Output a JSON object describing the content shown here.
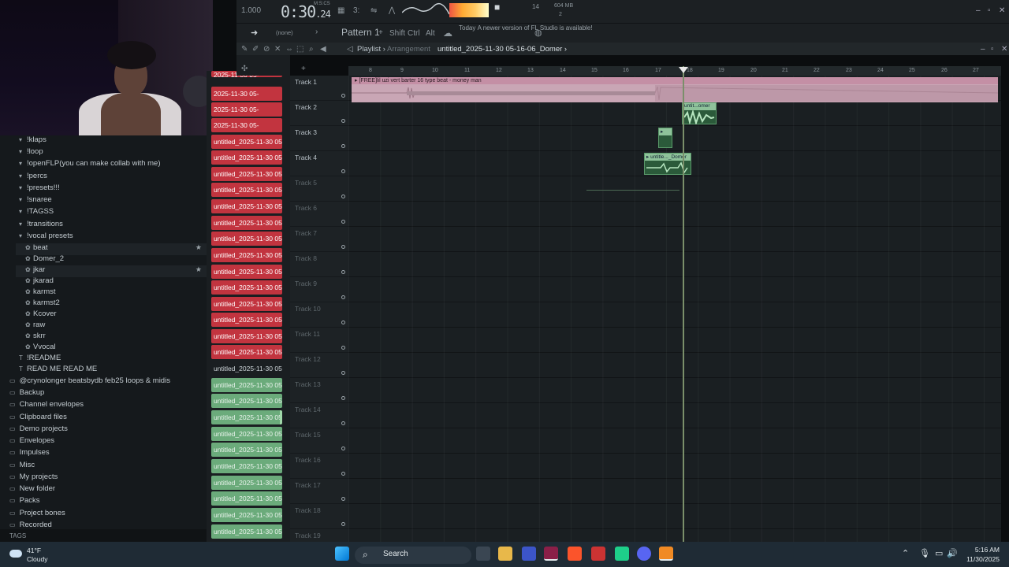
{
  "topbar": {
    "tempo": "1.000",
    "time_main": "0:30",
    "time_sub": "24",
    "time_label": "M:S:CS",
    "cpu": "14",
    "memory": "604 MB",
    "voices": "2"
  },
  "toolbar2": {
    "preset": "(none)",
    "pattern": "Pattern 1",
    "shift": "Shift",
    "ctrl": "Ctrl",
    "alt": "Alt",
    "hint_day": "Today",
    "hint_text": "A newer version of FL Studio is available!"
  },
  "playlist": {
    "title": "Playlist",
    "subtitle": "Arrangement",
    "file": "untitled_2025-11-30 05-16-06_Domer"
  },
  "browser": {
    "items": [
      {
        "label": "!klaps",
        "type": "folder"
      },
      {
        "label": "!loop",
        "type": "folder"
      },
      {
        "label": "!openFLP(you can make collab with me)",
        "type": "folder"
      },
      {
        "label": "!percs",
        "type": "folder"
      },
      {
        "label": "!presets!!!",
        "type": "folder"
      },
      {
        "label": "!snaree",
        "type": "folder"
      },
      {
        "label": "!TAGSS",
        "type": "folder"
      },
      {
        "label": "!transitions",
        "type": "folder"
      },
      {
        "label": "!vocal presets",
        "type": "folder"
      },
      {
        "label": "beat",
        "type": "preset",
        "star": true
      },
      {
        "label": "Domer_2",
        "type": "preset"
      },
      {
        "label": "jkar",
        "type": "preset",
        "star": true
      },
      {
        "label": "jkarad",
        "type": "preset"
      },
      {
        "label": "karmst",
        "type": "preset"
      },
      {
        "label": "karmst2",
        "type": "preset"
      },
      {
        "label": "Kcover",
        "type": "preset"
      },
      {
        "label": "raw",
        "type": "preset"
      },
      {
        "label": "skrr",
        "type": "preset"
      },
      {
        "label": "Vvocal",
        "type": "preset"
      },
      {
        "label": "!README",
        "type": "text"
      },
      {
        "label": "READ ME READ ME",
        "type": "text"
      },
      {
        "label": "@crynolonger beatsbydb feb25 loops & midis",
        "type": "root"
      },
      {
        "label": "Backup",
        "type": "root"
      },
      {
        "label": "Channel envelopes",
        "type": "root"
      },
      {
        "label": "Clipboard files",
        "type": "root"
      },
      {
        "label": "Demo projects",
        "type": "root"
      },
      {
        "label": "Envelopes",
        "type": "root"
      },
      {
        "label": "Impulses",
        "type": "root"
      },
      {
        "label": "Misc",
        "type": "root"
      },
      {
        "label": "My projects",
        "type": "root"
      },
      {
        "label": "New folder",
        "type": "root"
      },
      {
        "label": "Packs",
        "type": "root"
      },
      {
        "label": "Project bones",
        "type": "root"
      },
      {
        "label": "Recorded",
        "type": "root"
      }
    ],
    "tags_label": "TAGS"
  },
  "clips": {
    "partial_label": "2025-11-30 05-",
    "label": "untitled_2025-11-30 05-...",
    "colors": {
      "red": "#c2343f",
      "green": "#6bab7b"
    }
  },
  "tracks": [
    "Track 1",
    "Track 2",
    "Track 3",
    "Track 4",
    "Track 5",
    "Track 6",
    "Track 7",
    "Track 8",
    "Track 9",
    "Track 10",
    "Track 11",
    "Track 12",
    "Track 13",
    "Track 14",
    "Track 15",
    "Track 16",
    "Track 17",
    "Track 18",
    "Track 19"
  ],
  "ruler": [
    "8",
    "9",
    "10",
    "11",
    "12",
    "13",
    "14",
    "15",
    "16",
    "17",
    "18",
    "19",
    "20",
    "21",
    "22",
    "23",
    "24",
    "25",
    "26",
    "27"
  ],
  "arrangement": {
    "beat_clip": "[FREE]lil uzi vert  barter 16 type beat - money man",
    "vocal_clip_2": "untit...omer",
    "vocal_clip_4": "untitle..._Domer"
  },
  "taskbar": {
    "temp": "41°F",
    "cond": "Cloudy",
    "search": "Search",
    "time": "5:16 AM",
    "date": "11/30/2025"
  }
}
